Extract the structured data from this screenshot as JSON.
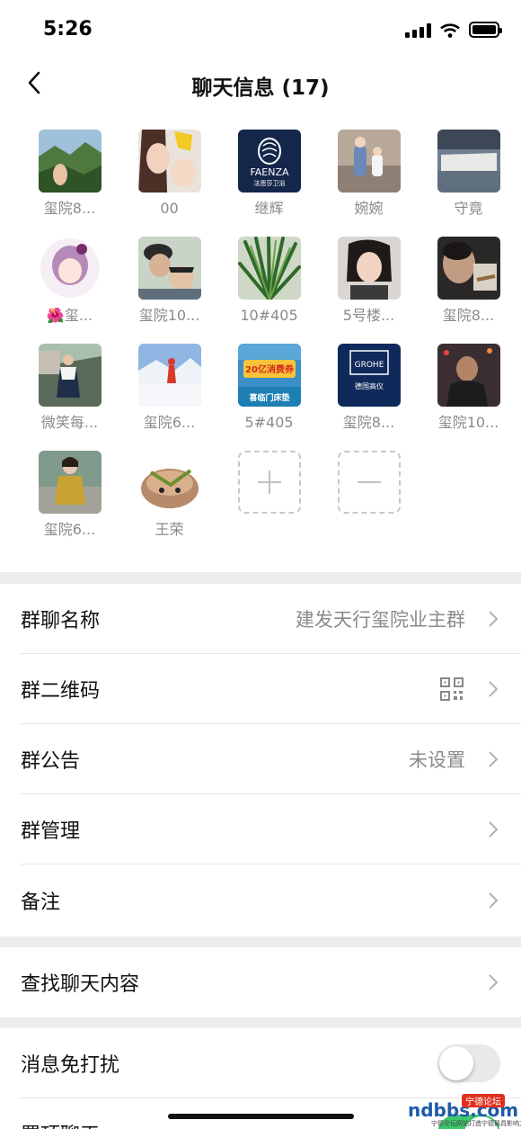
{
  "status_bar": {
    "time": "5:26"
  },
  "nav": {
    "title": "聊天信息 (17)"
  },
  "members": [
    {
      "name": "玺院8..."
    },
    {
      "name": "00"
    },
    {
      "name": "继辉",
      "logo_text": "FAENZA",
      "logo_sub": "法恩莎卫浴"
    },
    {
      "name": "婉婉"
    },
    {
      "name": "守竟"
    },
    {
      "name": "🌺玺..."
    },
    {
      "name": "玺院10..."
    },
    {
      "name": "10#405"
    },
    {
      "name": "5号楼..."
    },
    {
      "name": "玺院8..."
    },
    {
      "name": "微笑每..."
    },
    {
      "name": "玺院6..."
    },
    {
      "name": "5#405",
      "ad_big": "20亿消费券",
      "ad_small": "喜临门床垫"
    },
    {
      "name": "玺院8...",
      "logo_text": "GROHE",
      "logo_sub": "德国高仪"
    },
    {
      "name": "玺院10..."
    },
    {
      "name": "玺院6..."
    },
    {
      "name": "王荣"
    }
  ],
  "settings": {
    "group_name": {
      "label": "群聊名称",
      "value": "建发天行玺院业主群"
    },
    "group_qr": {
      "label": "群二维码"
    },
    "announcement": {
      "label": "群公告",
      "value": "未设置"
    },
    "manage": {
      "label": "群管理"
    },
    "remark": {
      "label": "备注"
    },
    "search": {
      "label": "查找聊天内容"
    },
    "mute": {
      "label": "消息免打扰",
      "on": false
    },
    "pin": {
      "label": "置顶聊天",
      "on": true
    }
  },
  "watermark": {
    "logo": "ndbbs.com",
    "tag": "宁德论坛",
    "sub": "宁德论坛网站打造宁德最具影响力的社区"
  },
  "colors": {
    "accent_green": "#3bc76a",
    "background": "#ededed"
  }
}
